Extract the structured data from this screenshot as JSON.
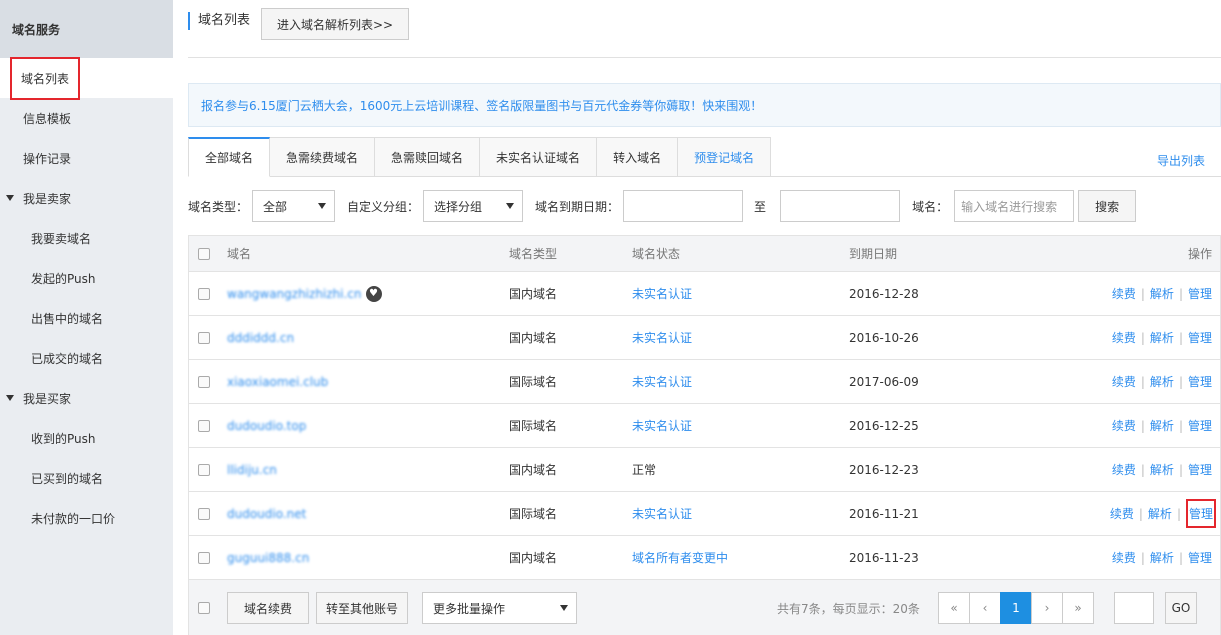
{
  "sidebar": {
    "title": "域名服务",
    "items": [
      {
        "label": "域名列表"
      },
      {
        "label": "信息模板"
      },
      {
        "label": "操作记录"
      }
    ],
    "seller": {
      "label": "我是卖家",
      "items": [
        {
          "label": "我要卖域名"
        },
        {
          "label": "发起的Push"
        },
        {
          "label": "出售中的域名"
        },
        {
          "label": "已成交的域名"
        }
      ]
    },
    "buyer": {
      "label": "我是买家",
      "items": [
        {
          "label": "收到的Push"
        },
        {
          "label": "已买到的域名"
        },
        {
          "label": "未付款的一口价"
        }
      ]
    }
  },
  "header": {
    "title": "域名列表",
    "jump_button": "进入域名解析列表>>"
  },
  "notice": "报名参与6.15厦门云栖大会，1600元上云培训课程、签名版限量图书与百元代金券等你薅取！快来围观！",
  "tabs": [
    "全部域名",
    "急需续费域名",
    "急需赎回域名",
    "未实名认证域名",
    "转入域名",
    "预登记域名"
  ],
  "export_link": "导出列表",
  "filters": {
    "type_label": "域名类型：",
    "type_value": "全部",
    "group_label": "自定义分组：",
    "group_value": "选择分组",
    "date_label": "域名到期日期：",
    "to": "至",
    "domain_label": "域名：",
    "domain_placeholder": "输入域名进行搜索",
    "search": "搜索"
  },
  "table": {
    "headers": {
      "name": "域名",
      "type": "域名类型",
      "status": "域名状态",
      "date": "到期日期",
      "ops": "操作"
    },
    "rows": [
      {
        "name": "wangwangzhizhizhi.cn",
        "type": "国内域名",
        "status": "未实名认证",
        "date": "2016-12-28"
      },
      {
        "name": "dddiddd.cn",
        "type": "国内域名",
        "status": "未实名认证",
        "date": "2016-10-26"
      },
      {
        "name": "xiaoxiaomei.club",
        "type": "国际域名",
        "status": "未实名认证",
        "date": "2017-06-09"
      },
      {
        "name": "dudoudio.top",
        "type": "国际域名",
        "status": "未实名认证",
        "date": "2016-12-25"
      },
      {
        "name": "llidiju.cn",
        "type": "国内域名",
        "status": "正常",
        "date": "2016-12-23"
      },
      {
        "name": "dudoudio.net",
        "type": "国际域名",
        "status": "未实名认证",
        "date": "2016-11-21"
      },
      {
        "name": "guguui888.cn",
        "type": "国内域名",
        "status": "域名所有者变更中",
        "date": "2016-11-23"
      }
    ],
    "ops": {
      "renew": "续费",
      "resolve": "解析",
      "manage": "管理"
    }
  },
  "footer": {
    "renew_btn": "域名续费",
    "transfer_btn": "转至其他账号",
    "batch_select": "更多批量操作",
    "summary": "共有7条，每页显示：20条",
    "pager": {
      "first": "«",
      "prev": "‹",
      "current": "1",
      "next": "›",
      "last": "»"
    },
    "go": "GO"
  },
  "colors": {
    "accent": "#2e8ded",
    "highlight": "#e4262d"
  }
}
